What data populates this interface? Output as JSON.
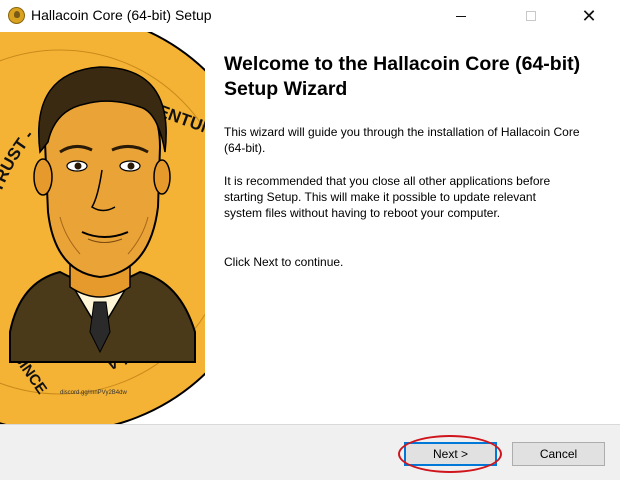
{
  "window": {
    "title": "Hallacoin Core (64-bit) Setup",
    "icon": "hallacoin-coin-icon",
    "controls": [
      "minimize-icon",
      "maximize-icon",
      "close-icon"
    ]
  },
  "coin": {
    "text_top_left": "WE TRUST -",
    "text_top_right": "- INVENTUM",
    "text_bottom_left": "- SINCE",
    "text_bottom_right": "S IN HALLA",
    "small_text": "discord.gg/mnPVy2B4dw",
    "color": "#f5b335"
  },
  "content": {
    "heading": "Welcome to the Hallacoin Core (64-bit) Setup Wizard",
    "paragraph1": "This wizard will guide you through the installation of Hallacoin Core (64-bit).",
    "paragraph2": "It is recommended that you close all other applications before starting Setup. This will make it possible to update relevant system files without having to reboot your computer.",
    "paragraph3": "Click Next to continue."
  },
  "buttons": {
    "next": "Next >",
    "cancel": "Cancel"
  },
  "colors": {
    "focus_border": "#0078d7",
    "highlight_ring": "#d0141c"
  }
}
